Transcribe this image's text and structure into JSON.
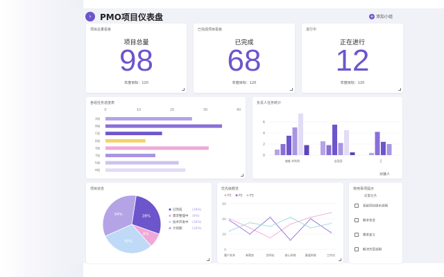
{
  "header": {
    "badge": "›",
    "title": "PMO项目仪表盘",
    "add_plus": "+",
    "add_label": "添加小组"
  },
  "kpis": [
    {
      "caption": "项目总量看板",
      "label": "项目总量",
      "value": "98",
      "target": "年度目标：120"
    },
    {
      "caption": "已完成项目看板",
      "label": "已完成",
      "value": "68",
      "target": "年度目标：120"
    },
    {
      "caption": "进行中",
      "label": "正在进行",
      "value": "12",
      "target": "年度目标：120"
    }
  ],
  "task_chart": {
    "caption": "各组任务进度表",
    "chart_data": {
      "type": "bar",
      "orientation": "horizontal",
      "x_ticks": [
        "0",
        "10",
        "20",
        "30",
        "40"
      ],
      "xlim": [
        0,
        40
      ],
      "categories": [
        "A组",
        "B组",
        "C组",
        "D组",
        "E组",
        "F组",
        "G组",
        "H组"
      ],
      "values": [
        26,
        35,
        17,
        12,
        31,
        15,
        22,
        24
      ],
      "colors": [
        "#b4a4e6",
        "#8a6fd8",
        "#6d55cc",
        "#f6d06a",
        "#f0a8d8",
        "#a896e2",
        "#cdc2f0",
        "#e2dcf6"
      ]
    }
  },
  "people_chart": {
    "caption": "负责人任务统计",
    "footer": "对接人",
    "chart_data": {
      "type": "bar",
      "y_ticks": [
        "0",
        "2",
        "4",
        "6"
      ],
      "ylim": [
        0,
        8
      ],
      "categories": [
        "曲维 刘利利",
        "吉田田",
        "王"
      ],
      "series_values": [
        [
          1,
          2,
          3.5,
          5,
          7.5,
          1.8
        ],
        [
          2.5,
          1.8,
          5.5,
          2.2,
          4.5,
          0.5
        ],
        [
          0.4,
          4.2,
          2.4,
          2
        ]
      ],
      "colors": [
        "#b4a4e6",
        "#8a6fd8",
        "#6d55cc",
        "#a896e2",
        "#e2dcf6",
        "#5b45b8"
      ]
    }
  },
  "status_chart": {
    "caption": "项目状态",
    "chart_data": {
      "type": "pie",
      "slices": [
        {
          "name": "已完成",
          "value": 28,
          "label": "28%",
          "pct": "(28%)",
          "color": "#6d55cc"
        },
        {
          "name": "需求整理中",
          "value": 8,
          "label": "8%",
          "pct": "(8%)",
          "color": "#f0a8d8"
        },
        {
          "name": "技术开发中",
          "value": 30,
          "label": "30%",
          "pct": "(30%)",
          "color": "#bfdaf6"
        },
        {
          "name": "计划期",
          "value": 34,
          "label": "34%",
          "pct": "(34%)",
          "color": "#b4a4e6"
        }
      ]
    }
  },
  "trend_chart": {
    "caption": "优先级概览",
    "chart_data": {
      "type": "line",
      "legend": [
        "P1",
        "P2",
        "P3"
      ],
      "y_ticks": [
        "0",
        "20",
        "40",
        "60"
      ],
      "ylim": [
        0,
        60
      ],
      "categories": [
        "客户关系",
        "新税务",
        "空间站",
        "核心系统",
        "渠道系统",
        "工作台"
      ],
      "series": [
        {
          "name": "P1",
          "values": [
            40,
            28,
            15,
            33,
            42,
            48
          ],
          "color": "#f0a8d8"
        },
        {
          "name": "P2",
          "values": [
            38,
            20,
            42,
            12,
            40,
            22
          ],
          "color": "#8a6fd8"
        },
        {
          "name": "P3",
          "values": [
            24,
            35,
            30,
            42,
            28,
            34
          ],
          "color": "#9fd8d8"
        }
      ]
    }
  },
  "tips": {
    "caption": "常用事项提示",
    "sub": "前置任务",
    "items": [
      "系统风险提示说明",
      "数字总览",
      "需求定义",
      "解决方案说明"
    ]
  }
}
